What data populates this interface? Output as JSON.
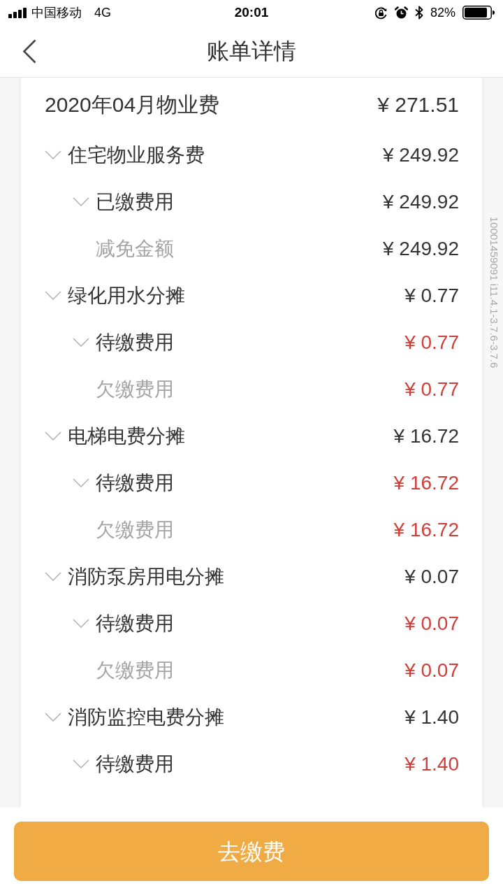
{
  "status_bar": {
    "carrier": "中国移动",
    "network": "4G",
    "time": "20:01",
    "battery": "82%"
  },
  "header": {
    "title": "账单详情"
  },
  "bill": {
    "title": "2020年04月物业费",
    "amount": "¥ 271.51",
    "items": [
      {
        "label": "住宅物业服务费",
        "amount": "¥ 249.92",
        "color": "#333333",
        "expanded": true,
        "children": [
          {
            "label": "已缴费用",
            "amount": "¥ 249.92",
            "color": "#333333",
            "expanded": true,
            "children": [
              {
                "label": "减免金额",
                "amount": "¥ 249.92",
                "color": "#333333"
              }
            ]
          }
        ]
      },
      {
        "label": "绿化用水分摊",
        "amount": "¥ 0.77",
        "color": "#333333",
        "expanded": true,
        "children": [
          {
            "label": "待缴费用",
            "amount": "¥ 0.77",
            "color": "#cf3e37",
            "expanded": true,
            "children": [
              {
                "label": "欠缴费用",
                "amount": "¥ 0.77",
                "color": "#cf3e37"
              }
            ]
          }
        ]
      },
      {
        "label": "电梯电费分摊",
        "amount": "¥ 16.72",
        "color": "#333333",
        "expanded": true,
        "children": [
          {
            "label": "待缴费用",
            "amount": "¥ 16.72",
            "color": "#cf3e37",
            "expanded": true,
            "children": [
              {
                "label": "欠缴费用",
                "amount": "¥ 16.72",
                "color": "#cf3e37"
              }
            ]
          }
        ]
      },
      {
        "label": "消防泵房用电分摊",
        "amount": "¥ 0.07",
        "color": "#333333",
        "expanded": true,
        "children": [
          {
            "label": "待缴费用",
            "amount": "¥ 0.07",
            "color": "#cf3e37",
            "expanded": true,
            "children": [
              {
                "label": "欠缴费用",
                "amount": "¥ 0.07",
                "color": "#cf3e37"
              }
            ]
          }
        ]
      },
      {
        "label": "消防监控电费分摊",
        "amount": "¥ 1.40",
        "color": "#333333",
        "expanded": true,
        "children": [
          {
            "label": "待缴费用",
            "amount": "¥ 1.40",
            "color": "#cf3e37",
            "expanded": true
          }
        ]
      }
    ]
  },
  "version_label": "10001459091 i11.4.1-3.7.6-3.7.6",
  "pay_button": {
    "label": "去缴费"
  }
}
